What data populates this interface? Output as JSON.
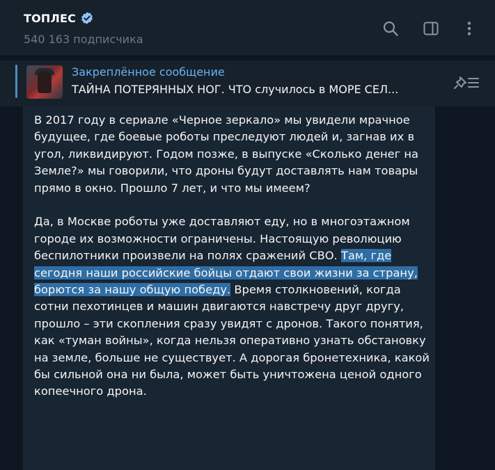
{
  "header": {
    "channel_name": "ТОПЛЕС",
    "subscribers": "540 163 подписчика",
    "icons": [
      "verified-badge-icon",
      "search-icon",
      "sidebar-toggle-icon",
      "more-vertical-icon"
    ]
  },
  "pinned": {
    "title": "Закреплённое сообщение",
    "text": "ТАЙНА ПОТЕРЯННЫХ НОГ. ЧТО случилось в МОРЕ СЕЛ...",
    "icons": [
      "pinned-list-icon"
    ]
  },
  "message": {
    "p1": "В 2017 году в сериале «Черное зеркало» мы увидели мрачное будущее, где боевые роботы преследуют людей и, загнав их в угол, ликвидируют. Годом позже, в выпуске «Сколько денег на Земле?» мы говорили, что дроны будут доставлять нам товары прямо в окно. Прошло 7 лет, и что мы имеем?",
    "p2_before": "Да, в Москве роботы уже доставляют еду, но в многоэтажном городе их возможности ограничены. Настоящую революцию беспилотники произвели на полях сражений СВО. ",
    "p2_highlight": "Там, где сегодня наши российские бойцы отдают свои жизни за страну, борются за нашу общую победу.",
    "p2_after": " Время столкновений, когда сотни пехотинцев и машин двигаются навстречу друг другу, прошло – эти скопления сразу увидят с дронов. Такого понятия, как «туман войны», когда нельзя оперативно узнать обстановку на земле, больше не существует. А дорогая бронетехника, какой бы сильной она ни была, может быть уничтожена ценой одного копеечного дрона."
  },
  "colors": {
    "background": "#0e1621",
    "panel": "#17212b",
    "bubble": "#182533",
    "accent": "#6ab3f3",
    "selection": "#2f6ea5"
  }
}
